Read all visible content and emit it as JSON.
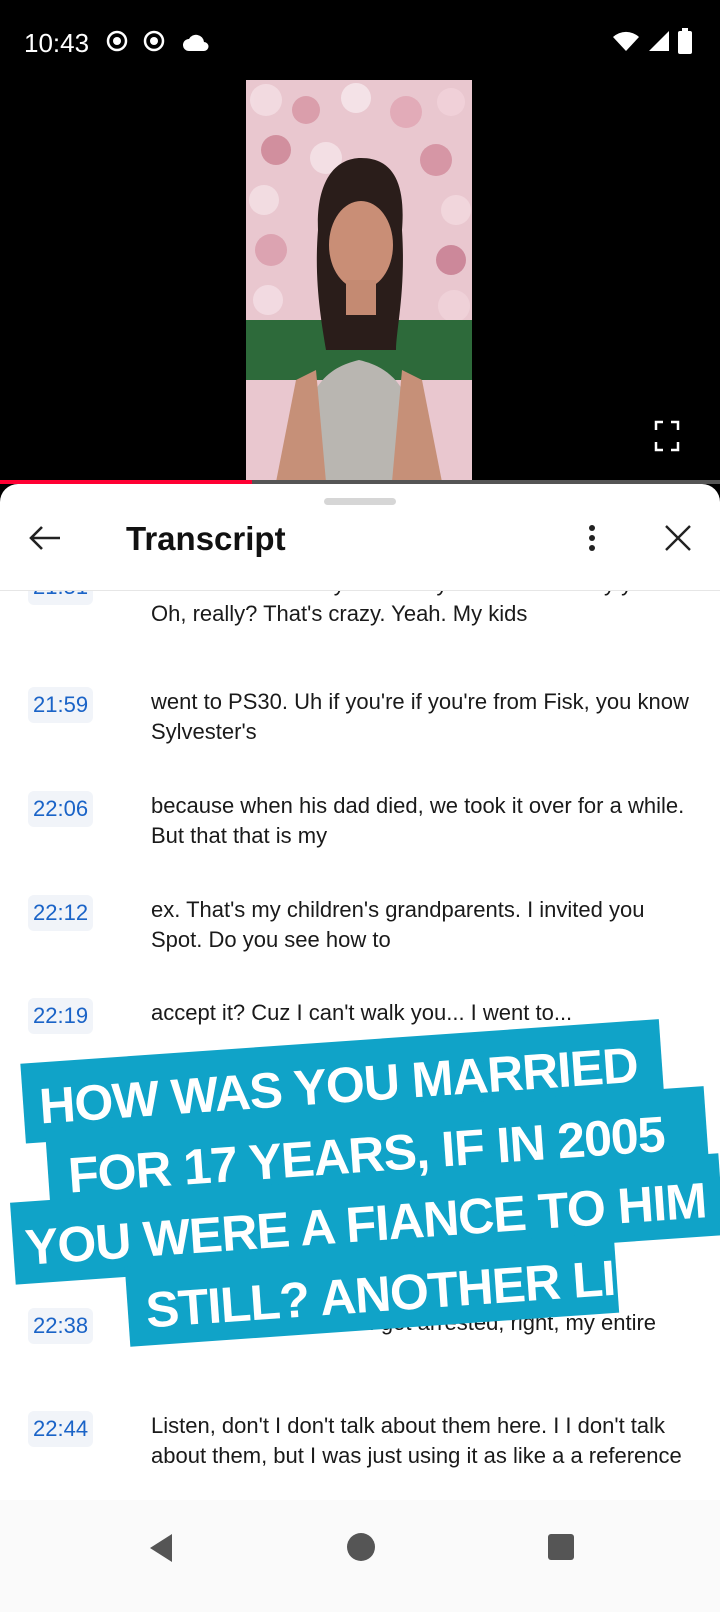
{
  "status_bar": {
    "time": "10:43"
  },
  "player": {
    "progress_fraction": 0.35
  },
  "transcript": {
    "title": "Transcript",
    "segments": [
      {
        "time": "21:51",
        "text": "ex-husband's family owned Sylvesters for many years. Oh, really? That's crazy. Yeah. My kids"
      },
      {
        "time": "21:59",
        "text": "went to PS30. Uh if you're if you're from Fisk, you know Sylvester's"
      },
      {
        "time": "22:06",
        "text": "because when his dad died, we took it over for a while. But that that is my"
      },
      {
        "time": "22:12",
        "text": "ex. That's my children's grandparents. I invited you Spot. Do you see how to"
      },
      {
        "time": "22:19",
        "text": "accept it? Cuz I can't walk you... I went to..."
      },
      {
        "time": "22:38",
        "text": "... was because when I got arrested, right, my entire"
      },
      {
        "time": "22:44",
        "text": "Listen, don't I don't talk about them here. I I don't talk about them, but I was just using it as like a a reference"
      }
    ]
  },
  "overlay": {
    "lines": [
      "HOW WAS YOU MARRIED",
      "FOR 17 YEARS, IF IN 2005",
      "YOU WERE A FIANCE TO HIM",
      "STILL? ANOTHER LIE"
    ]
  }
}
